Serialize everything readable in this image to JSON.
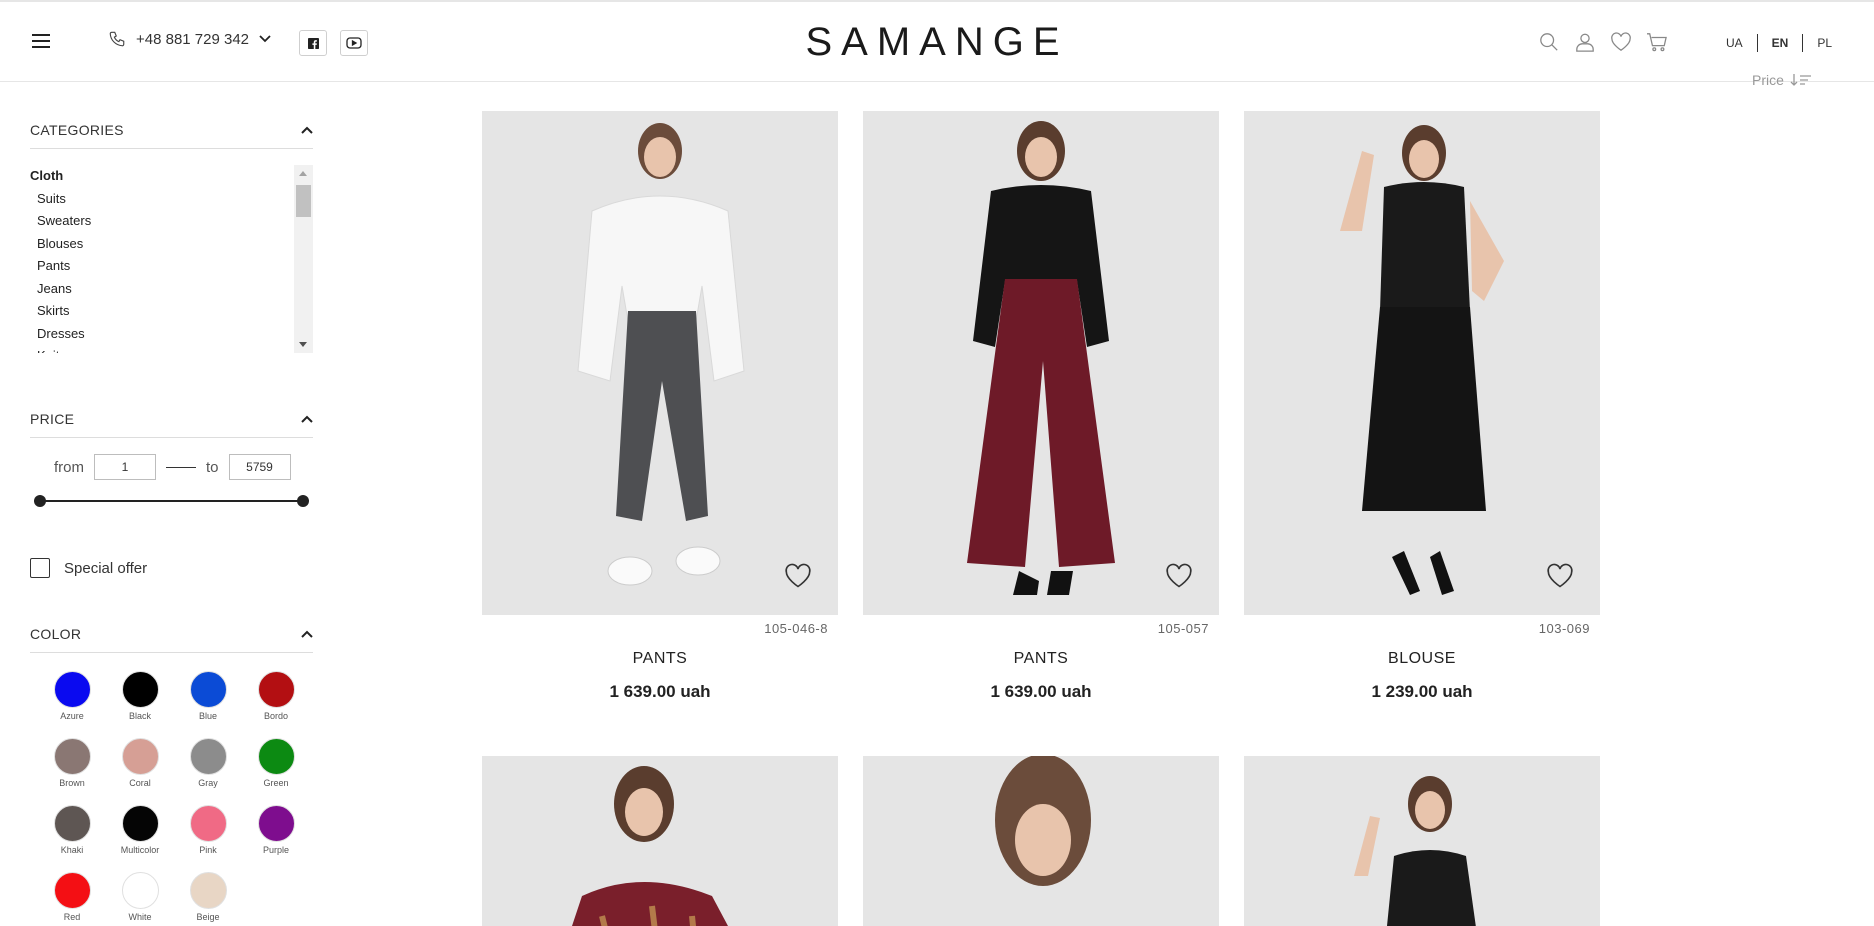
{
  "header": {
    "phone": "+48 881 729 342",
    "logo": "SAMANGE",
    "languages": [
      "UA",
      "EN",
      "PL"
    ],
    "active_language": "EN"
  },
  "sort": {
    "label": "Price"
  },
  "filters": {
    "categories_title": "CATEGORIES",
    "category_parent": "Cloth",
    "categories": [
      "Suits",
      "Sweaters",
      "Blouses",
      "Pants",
      "Jeans",
      "Skirts",
      "Dresses",
      "Knitwear"
    ],
    "price_title": "PRICE",
    "price_from_label": "from",
    "price_to_label": "to",
    "price_from": "1",
    "price_to": "5759",
    "special_offer": "Special offer",
    "color_title": "COLOR",
    "colors": [
      {
        "name": "Azure",
        "hex": "#0a0af0"
      },
      {
        "name": "Black",
        "hex": "#000000"
      },
      {
        "name": "Blue",
        "hex": "#0b4bd6"
      },
      {
        "name": "Bordo",
        "hex": "#b30f12"
      },
      {
        "name": "Brown",
        "hex": "#8a7773"
      },
      {
        "name": "Coral",
        "hex": "#d69f95"
      },
      {
        "name": "Gray",
        "hex": "#8c8c8c"
      },
      {
        "name": "Green",
        "hex": "#0c8a12"
      },
      {
        "name": "Khaki",
        "hex": "#5e5653"
      },
      {
        "name": "Multicolor",
        "hex": "#050505"
      },
      {
        "name": "Pink",
        "hex": "#f06a85"
      },
      {
        "name": "Purple",
        "hex": "#7e0d8e"
      },
      {
        "name": "Red",
        "hex": "#f40f14"
      },
      {
        "name": "White",
        "hex": "#ffffff"
      },
      {
        "name": "Beige",
        "hex": "#e8d6c5"
      }
    ]
  },
  "products": [
    {
      "sku": "105-046-8",
      "name": "PANTS",
      "price": "1 639.00 uah"
    },
    {
      "sku": "105-057",
      "name": "PANTS",
      "price": "1 639.00 uah"
    },
    {
      "sku": "103-069",
      "name": "BLOUSE",
      "price": "1 239.00 uah"
    }
  ]
}
